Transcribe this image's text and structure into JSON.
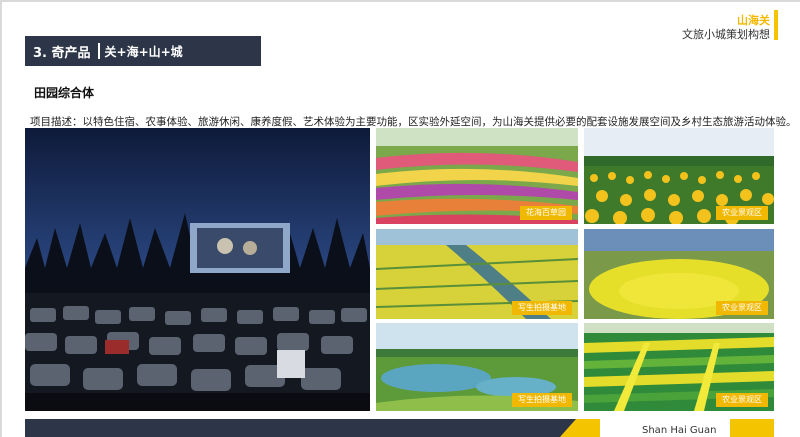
{
  "brand": {
    "name": "山海关",
    "subtitle": "文旅小城策划构想"
  },
  "section": {
    "title": "3. 奇产品",
    "subtitle": "关+海+山+城"
  },
  "subheading": "田园综合体",
  "description": "项目描述：以特色住宿、农事体验、旅游休闲、康养度假、艺术体验为主要功能，区实验外延空间，为山海关提供必要的配套设施发展空间及乡村生态旅游活动体验。",
  "photos": {
    "main": {
      "caption": ""
    },
    "r1c1": {
      "tag": "花海百草园"
    },
    "r1c2": {
      "tag": "农业景观区"
    },
    "r2c1": {
      "tag": "写生拍摄基地"
    },
    "r2c2": {
      "tag": "农业景观区"
    },
    "r3c1": {
      "tag": "写生拍摄基地"
    },
    "r3c2": {
      "tag": "农业景观区"
    }
  },
  "footer": {
    "text": "Shan Hai Guan"
  },
  "colors": {
    "navy": "#2d3648",
    "accent": "#f5c400"
  }
}
